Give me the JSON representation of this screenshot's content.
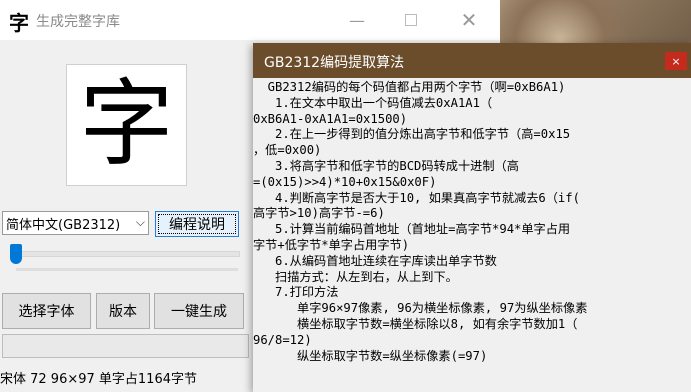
{
  "app": {
    "icon_glyph": "字",
    "title": "生成完整字库",
    "preview_char": "字",
    "encoding_selected": "简体中文(GB2312)",
    "help_button": "编程说明",
    "slider_value": 0,
    "buttons": {
      "choose_font": "选择字体",
      "version": "版本",
      "generate": "一键生成"
    },
    "status_text": "宋体  72 96×97  单字占1164字节"
  },
  "window_controls": {
    "minimize": "—",
    "close": "✕"
  },
  "popup": {
    "title": "GB2312编码提取算法",
    "close_glyph": "×",
    "lines": [
      "  GB2312编码的每个码值都占用两个字节（啊=0xB6A1)",
      "   1.在文本中取出一个码值减去0xA1A1（",
      "0xB6A1-0xA1A1=0x1500)",
      "   2.在上一步得到的值分炼出高字节和低字节（高=0x15",
      "，低=0x00)",
      "   3.将高字节和低字节的BCD码转成十进制（高",
      "=(0x15)>>4)*10+0x15&0x0F)",
      "   4.判断高字节是否大于10, 如果真高字节就减去6（if(",
      "高字节>10)高字节-=6)",
      "   5.计算当前编码首地址（首地址=高字节*94*单字占用",
      "字节+低字节*单字占用字节)",
      "   6.从编码首地址连续在字库读出单字节数",
      "   扫描方式：从左到右，从上到下。",
      "   7.打印方法",
      "      单字96×97像素, 96为横坐标像素, 97为纵坐标像素",
      "      横坐标取字节数=横坐标除以8, 如有余字节数加1（",
      "96/8=12)",
      "      纵坐标取字节数=纵坐标像素(=97)"
    ]
  },
  "colors": {
    "popup_titlebar": "#6b4d2c",
    "popup_close": "#c42b1c",
    "slider_accent": "#0078d7"
  }
}
